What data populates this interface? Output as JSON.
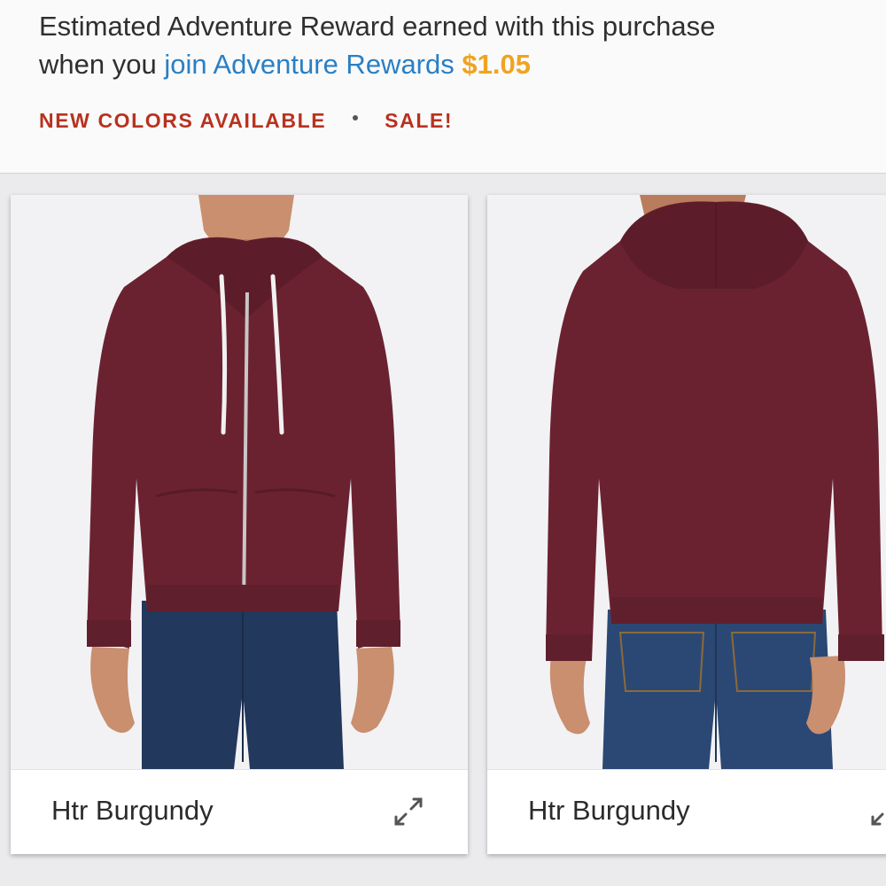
{
  "reward": {
    "line1": "Estimated Adventure Reward earned with this purchase",
    "prefix": "when you",
    "link_text": "join Adventure Rewards",
    "amount": "$1.05"
  },
  "badges": {
    "new_colors": "NEW COLORS AVAILABLE",
    "sale": "SALE!"
  },
  "colors": {
    "reward_link": "#2a7fc4",
    "reward_amount": "#f0a321",
    "badge_text": "#b8321f",
    "hoodie": "#6b2230"
  },
  "product_images": [
    {
      "view": "front",
      "color_name": "Htr Burgundy",
      "icon": "expand-icon"
    },
    {
      "view": "back",
      "color_name": "Htr Burgundy",
      "icon": "expand-icon"
    }
  ]
}
